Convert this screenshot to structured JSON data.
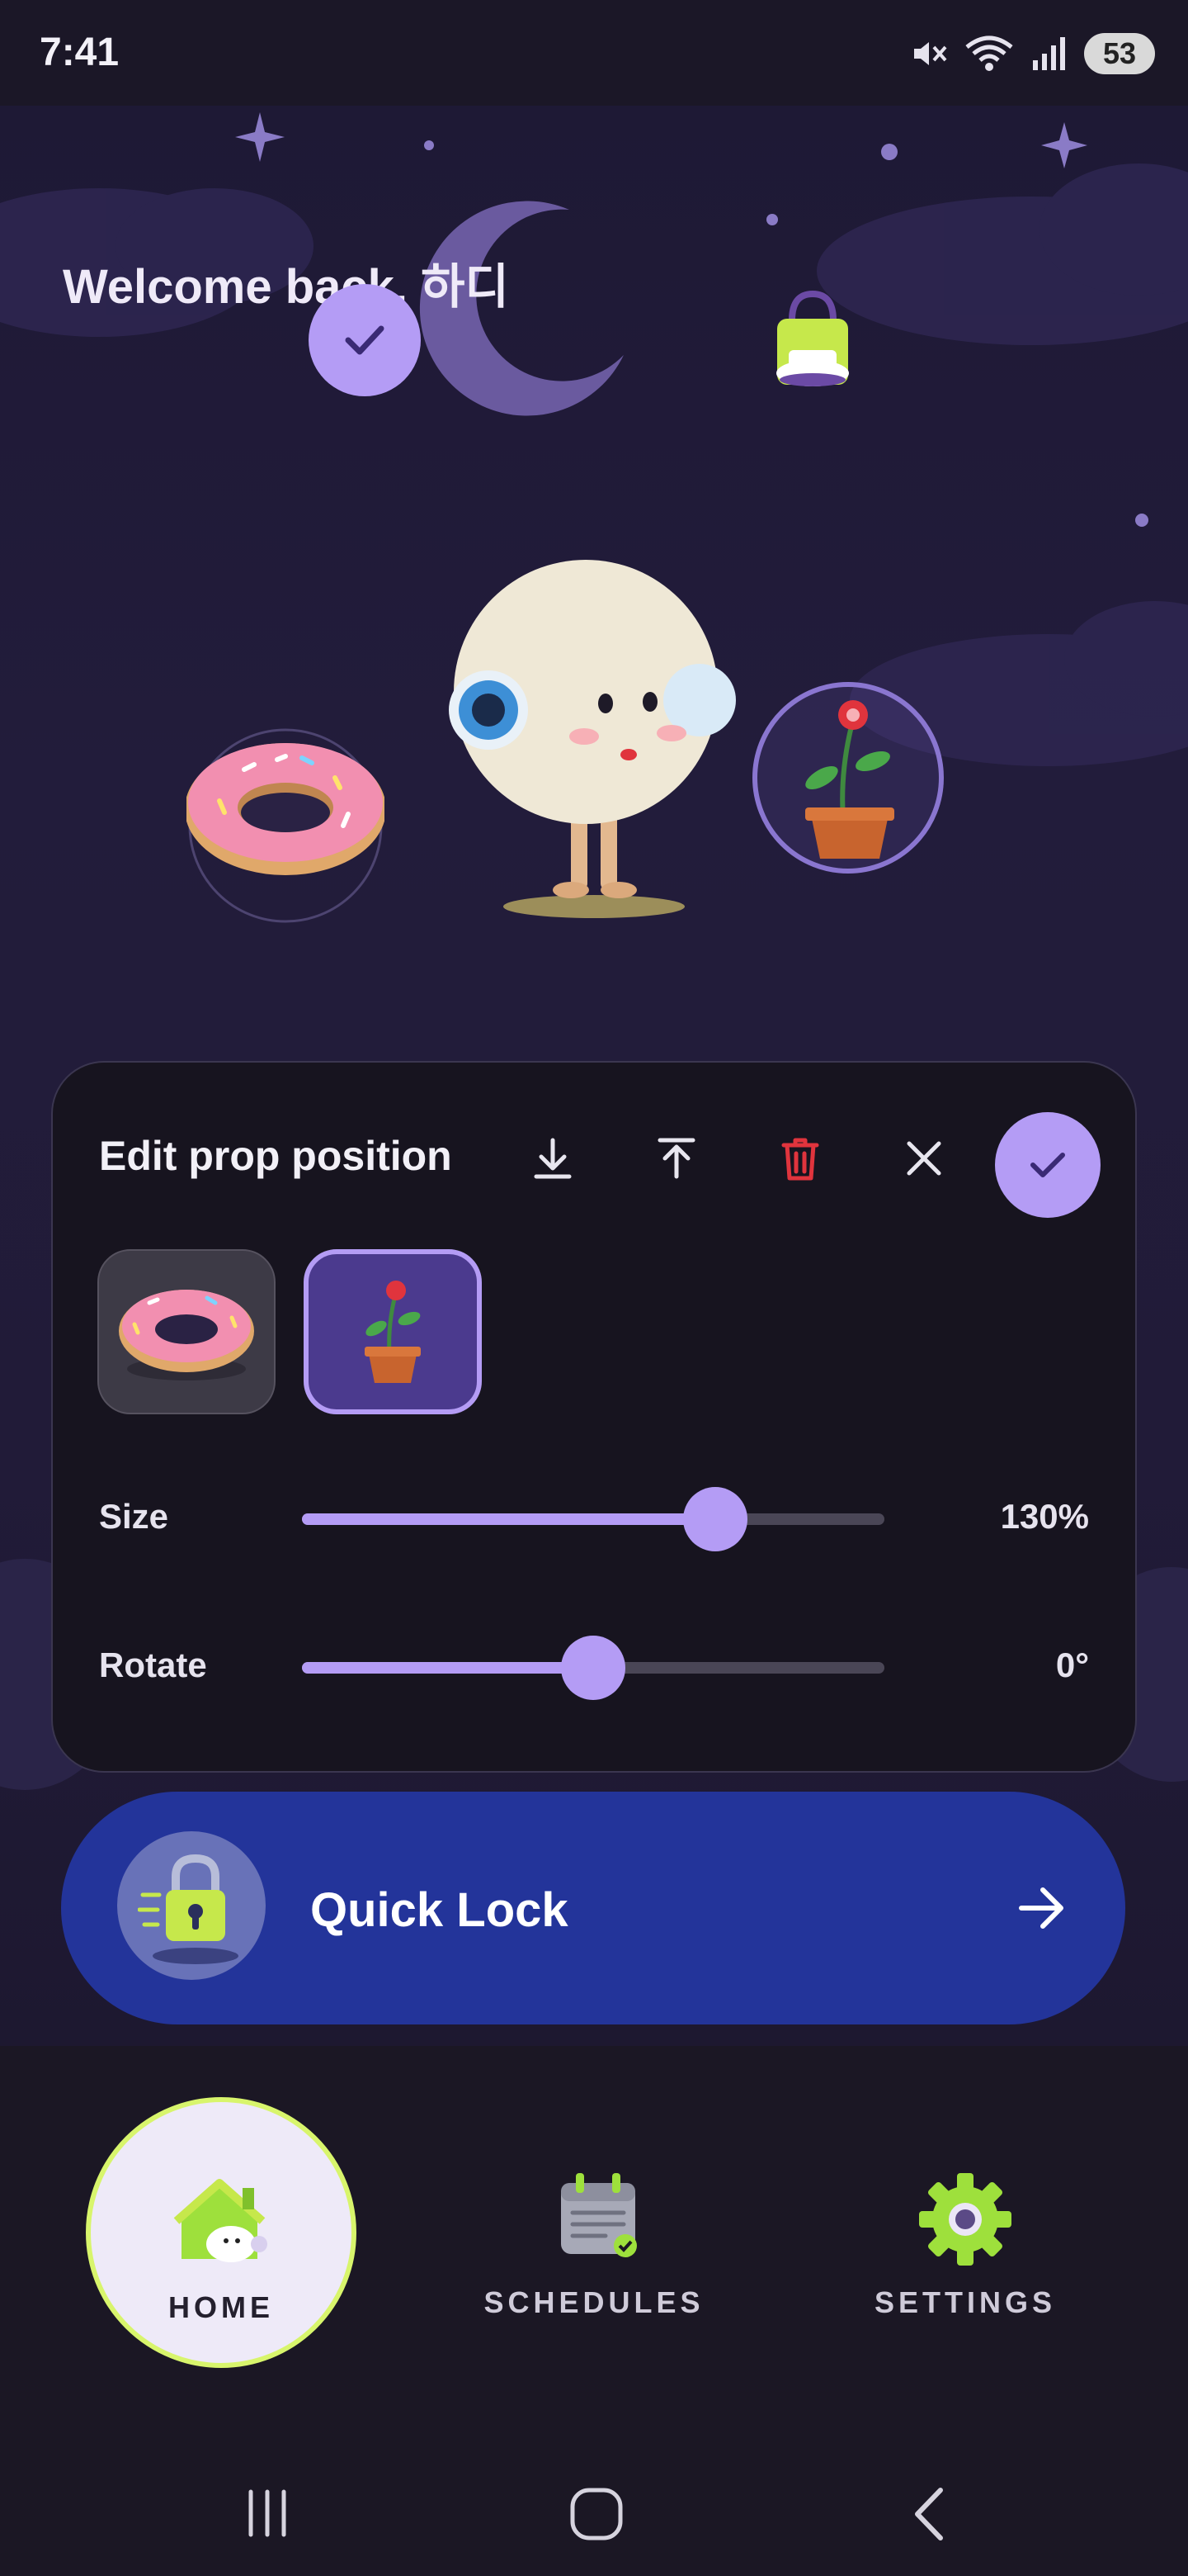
{
  "status_bar": {
    "time": "7:41",
    "battery": "53"
  },
  "header": {
    "welcome": "Welcome back, 하디"
  },
  "edit_panel": {
    "title": "Edit prop position",
    "props": [
      "donut",
      "potted-plant"
    ],
    "selected_prop": "potted-plant",
    "size": {
      "label": "Size",
      "value_text": "130%",
      "fraction": 0.71
    },
    "rotate": {
      "label": "Rotate",
      "value_text": "0°",
      "fraction": 0.5
    }
  },
  "quick_lock": {
    "label": "Quick Lock"
  },
  "nav": {
    "home": "HOME",
    "schedules": "SCHEDULES",
    "settings": "SETTINGS",
    "active": "home"
  },
  "colors": {
    "accent": "#b49cf5",
    "quick_lock_bg": "#23349a",
    "home_ring": "#d8f56c",
    "delete": "#e0343d"
  }
}
